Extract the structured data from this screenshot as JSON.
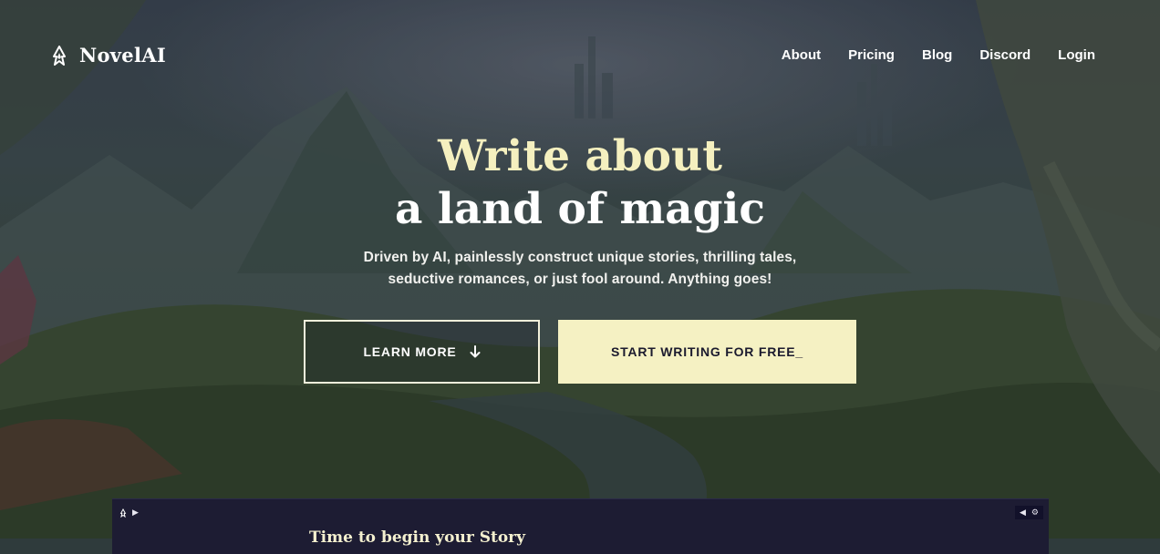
{
  "brand": {
    "name": "NovelAI",
    "logo_icon": "novelai-logo-icon"
  },
  "nav": {
    "links": [
      "About",
      "Pricing",
      "Blog",
      "Discord",
      "Login"
    ]
  },
  "hero": {
    "headline_line1": "Write about",
    "headline_line2": "a land of magic",
    "subtitle": "Driven by AI, painlessly construct unique stories, thrilling tales, seductive romances, or just fool around. Anything goes!"
  },
  "buttons": {
    "learn_more": "LEARN MORE",
    "learn_more_icon": "arrow-down-icon",
    "start_writing": "START WRITING FOR FREE_"
  },
  "preview": {
    "title": "Time to begin your Story"
  },
  "colors": {
    "accent": "#f5f1c3",
    "panel": "#1d1c33",
    "headline_accent": "#f5f0bf"
  }
}
